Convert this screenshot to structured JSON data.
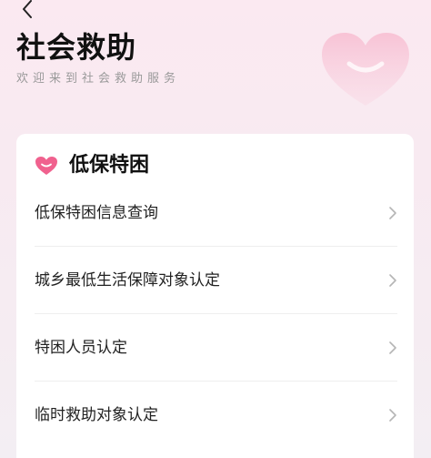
{
  "header": {
    "title": "社会救助",
    "subtitle": "欢迎来到社会救助服务",
    "back_icon": "chevron-left-icon",
    "decor_icon": "heart-icon"
  },
  "card": {
    "icon": "heart-icon",
    "title": "低保特困",
    "items": [
      {
        "label": "低保特困信息查询",
        "icon": "chevron-right-icon"
      },
      {
        "label": "城乡最低生活保障对象认定",
        "icon": "chevron-right-icon"
      },
      {
        "label": "特困人员认定",
        "icon": "chevron-right-icon"
      },
      {
        "label": "临时救助对象认定",
        "icon": "chevron-right-icon"
      }
    ]
  },
  "colors": {
    "accent_pink": "#f0618e",
    "background": "#fbe9f1",
    "card": "#ffffff",
    "text_primary": "#111111",
    "text_secondary": "#9a9a9a"
  }
}
